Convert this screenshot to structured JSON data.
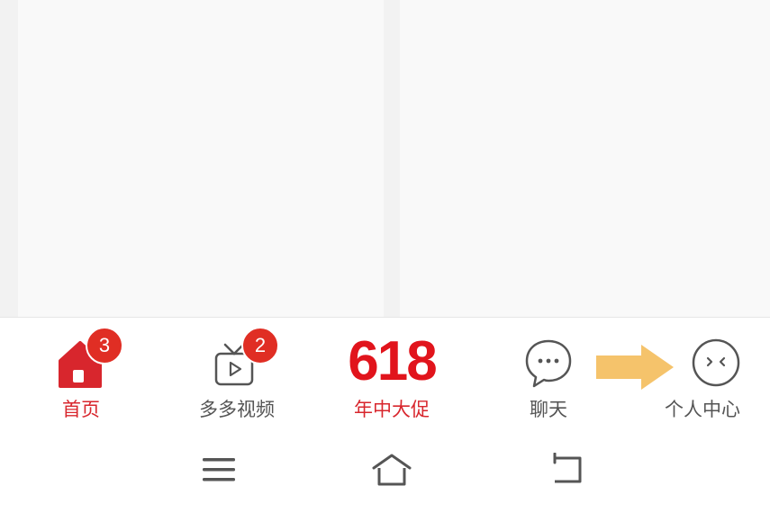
{
  "colors": {
    "accent": "#d8262d",
    "badge": "#e02e24",
    "arrow": "#f5c36b",
    "inactive": "#555555"
  },
  "tabs": [
    {
      "label": "首页",
      "icon": "home-icon",
      "badge": "3",
      "active": true
    },
    {
      "label": "多多视频",
      "icon": "tv-play-icon",
      "badge": "2",
      "active": false
    },
    {
      "label": "年中大促",
      "icon": "promo-618-icon",
      "promo_text": "618",
      "active": true
    },
    {
      "label": "聊天",
      "icon": "chat-bubble-icon",
      "active": false
    },
    {
      "label": "个人中心",
      "icon": "profile-face-icon",
      "active": false
    }
  ],
  "system_nav": {
    "menu": "menu-icon",
    "home": "home-outline-icon",
    "back": "back-icon"
  }
}
